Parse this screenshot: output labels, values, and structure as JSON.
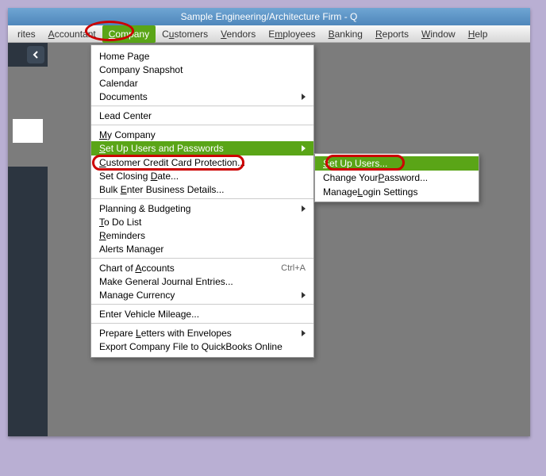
{
  "title": "Sample Engineering/Architecture Firm  - Q",
  "menu": {
    "favorites": "rites",
    "accountant": "Accountant",
    "company": "Company",
    "customers": "Customers",
    "vendors": "Vendors",
    "employees": "Employees",
    "banking": "Banking",
    "reports": "Reports",
    "window": "Window",
    "help": "Help"
  },
  "drop": {
    "home": "Home Page",
    "snapshot": "Company Snapshot",
    "calendar": "Calendar",
    "documents": "Documents",
    "leadcenter": "Lead Center",
    "mycompany": "My Company",
    "setup_users_pw": "Set Up Users and Passwords",
    "cc_protection": "Customer Credit Card Protection...",
    "closing_date": "Set Closing Date...",
    "bulk_enter": "Bulk Enter Business Details...",
    "planning": "Planning & Budgeting",
    "todo": "To Do List",
    "reminders": "Reminders",
    "alerts": "Alerts Manager",
    "coa": "Chart of Accounts",
    "coa_sc": "Ctrl+A",
    "journal": "Make General Journal Entries...",
    "currency": "Manage Currency",
    "mileage": "Enter Vehicle Mileage...",
    "letters": "Prepare Letters with Envelopes",
    "export": "Export Company File to QuickBooks Online"
  },
  "sub": {
    "set_users": "Set Up Users...",
    "change_pw": "Change Your Password...",
    "login_settings": "Manage Login Settings"
  }
}
